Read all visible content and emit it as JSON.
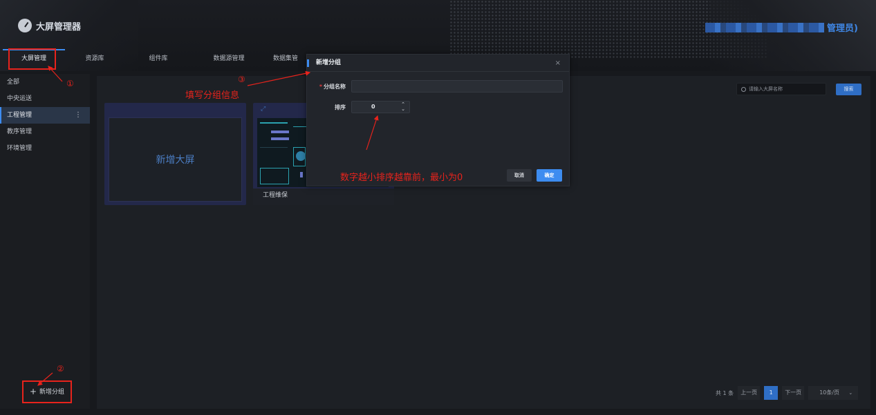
{
  "app": {
    "title": "大屏管理器",
    "admin_name": "管理员)"
  },
  "nav": {
    "tabs": [
      {
        "label": "大屏管理",
        "active": true
      },
      {
        "label": "资源库"
      },
      {
        "label": "组件库"
      },
      {
        "label": "数据源管理"
      },
      {
        "label": "数据集管"
      }
    ]
  },
  "sidebar": {
    "items": [
      {
        "label": "全部"
      },
      {
        "label": "中央运送"
      },
      {
        "label": "工程管理",
        "active": true,
        "more": "⋮"
      },
      {
        "label": "教序管理"
      },
      {
        "label": "环境管理"
      }
    ],
    "add_group_label": "新增分组",
    "add_group_icon": "+"
  },
  "main": {
    "search_placeholder": "请输入大屏名称",
    "search_button": "搜索",
    "new_screen_label": "新增大屏",
    "project_card_caption": "工程维保",
    "pager": {
      "total": "共 1 条",
      "prev": "上一页",
      "page": "1",
      "next": "下一页",
      "page_size": "10条/页"
    }
  },
  "dialog": {
    "title": "新增分组",
    "close": "×",
    "name_label": "分组名称",
    "name_value": "",
    "order_label": "排序",
    "order_value": "0",
    "cancel": "取消",
    "ok": "确定"
  },
  "annotations": {
    "step1": "①",
    "step2": "②",
    "step3": "③",
    "fill_info": "填写分组信息",
    "order_hint": "数字越小排序越靠前，最小为0",
    "color": "#e8231c"
  }
}
